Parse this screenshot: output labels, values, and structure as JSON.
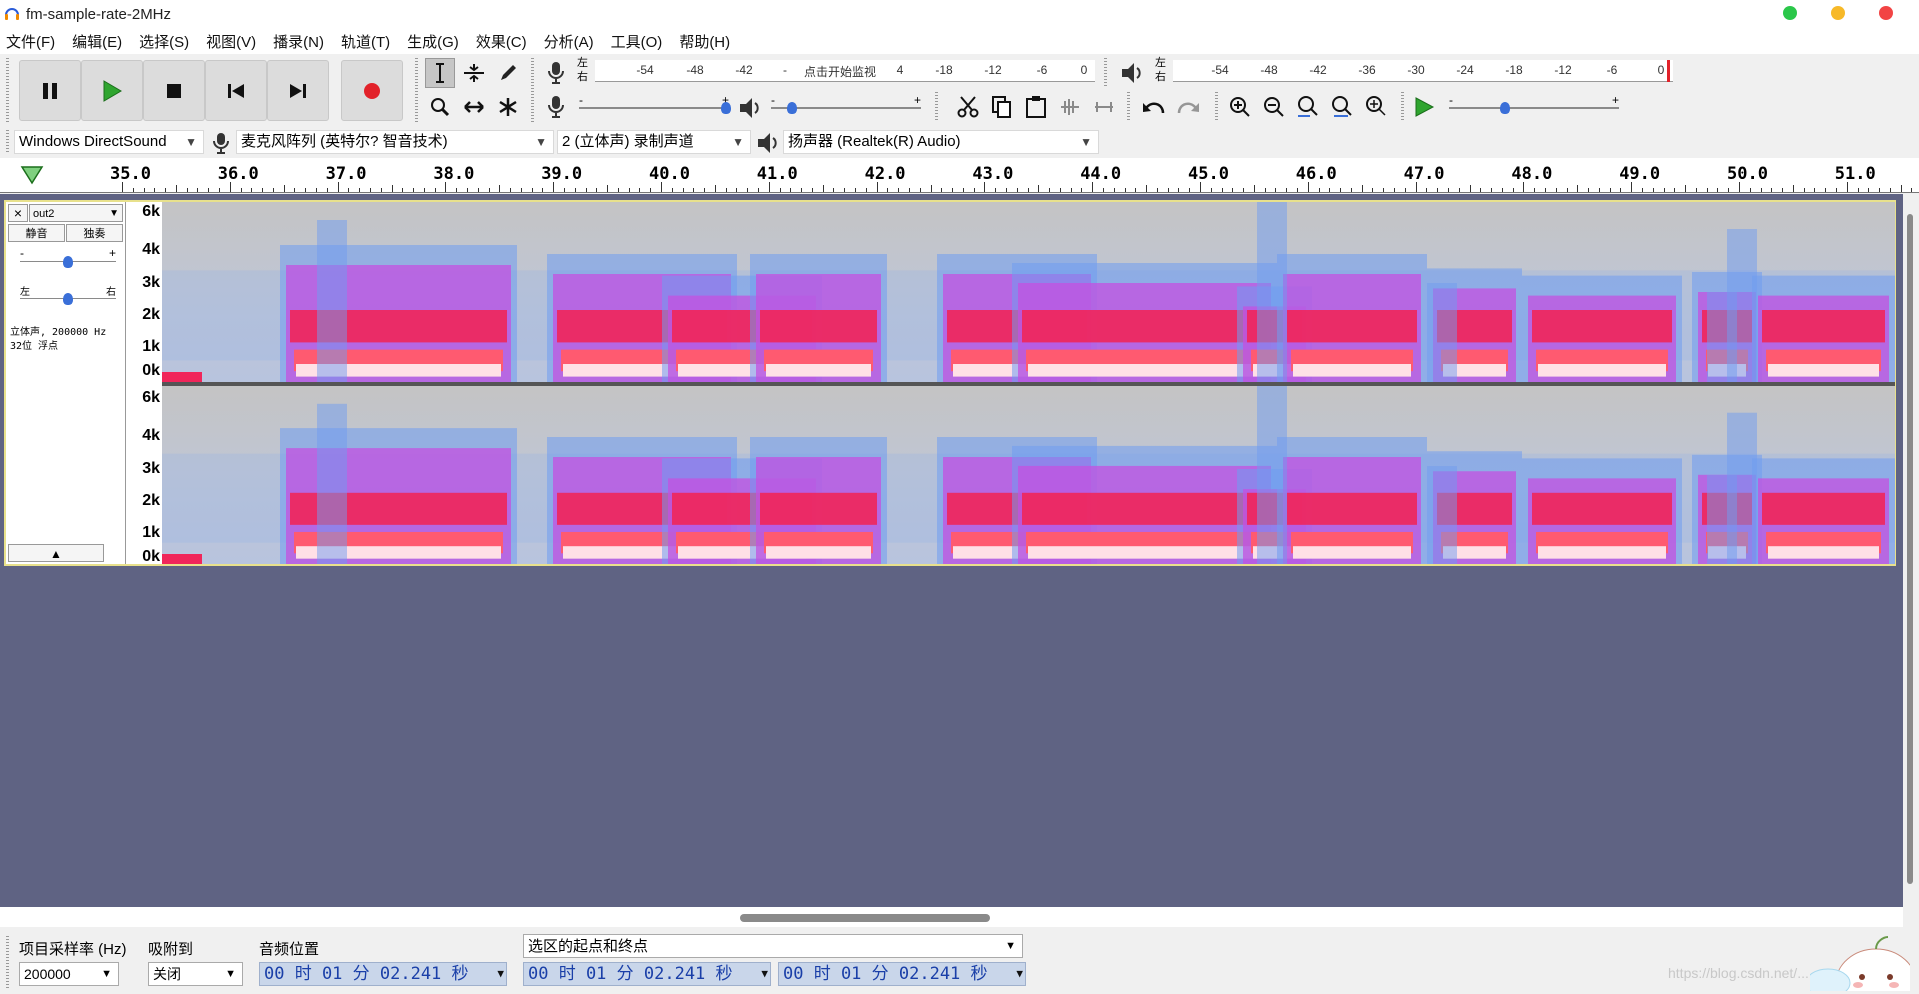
{
  "window": {
    "title": "fm-sample-rate-2MHz"
  },
  "menu": [
    "文件(F)",
    "编辑(E)",
    "选择(S)",
    "视图(V)",
    "播录(N)",
    "轨道(T)",
    "生成(G)",
    "效果(C)",
    "分析(A)",
    "工具(O)",
    "帮助(H)"
  ],
  "colors": {
    "accent": "#3a6fd8",
    "play": "#2fa52f",
    "record": "#e2222a",
    "track_bg": "#5f6383",
    "track_border": "#e8e18c"
  },
  "transport": {
    "buttons": [
      {
        "name": "pause",
        "icon": "pause-icon"
      },
      {
        "name": "play",
        "icon": "play-icon"
      },
      {
        "name": "stop",
        "icon": "stop-icon"
      },
      {
        "name": "skip-start",
        "icon": "skip-start-icon"
      },
      {
        "name": "skip-end",
        "icon": "skip-end-icon"
      },
      {
        "name": "record",
        "icon": "record-icon"
      }
    ]
  },
  "meters": {
    "record": {
      "lr_top": "左",
      "lr_bottom": "右",
      "ticks": [
        "-54",
        "-48",
        "-42",
        "-",
        "4",
        "-18",
        "-12",
        "-6",
        "0"
      ],
      "hint": "点击开始监视"
    },
    "playback": {
      "lr_top": "左",
      "lr_bottom": "右",
      "ticks": [
        "-54",
        "-48",
        "-42",
        "-36",
        "-30",
        "-24",
        "-18",
        "-12",
        "-6",
        "0"
      ]
    }
  },
  "sliders": {
    "minus": "-",
    "plus": "+"
  },
  "devices": {
    "host": "Windows DirectSound",
    "mic": "麦克风阵列 (英特尔? 智音技术)",
    "channels": "2 (立体声) 录制声道",
    "speaker": "扬声器 (Realtek(R) Audio)"
  },
  "ruler": {
    "ticks": [
      "35.0",
      "36.0",
      "37.0",
      "38.0",
      "39.0",
      "40.0",
      "41.0",
      "42.0",
      "43.0",
      "44.0",
      "45.0",
      "46.0",
      "47.0",
      "48.0",
      "49.0",
      "50.0",
      "51.0"
    ]
  },
  "track": {
    "close": "×",
    "name": "out2",
    "mute": "静音",
    "solo": "独奏",
    "gain_minus": "-",
    "gain_plus": "+",
    "pan_left": "左",
    "pan_right": "右",
    "info_line1": "立体声, 200000 Hz",
    "info_line2": "32位 浮点",
    "collapse": "▲",
    "freq_labels": [
      "6k",
      "4k",
      "3k",
      "2k",
      "1k",
      "0k"
    ]
  },
  "selection_bar": {
    "rate_label": "项目采样率 (Hz)",
    "rate_value": "200000",
    "snap_label": "吸附到",
    "snap_value": "关闭",
    "pos_label": "音频位置",
    "pos_value": "00 时 01 分 02.241 秒",
    "sel_label": "选区的起点和终点",
    "sel_start": "00 时 01 分 02.241 秒",
    "sel_end": "00 时 01 分 02.241 秒"
  },
  "watermark": "https://blog.csdn.net/..."
}
